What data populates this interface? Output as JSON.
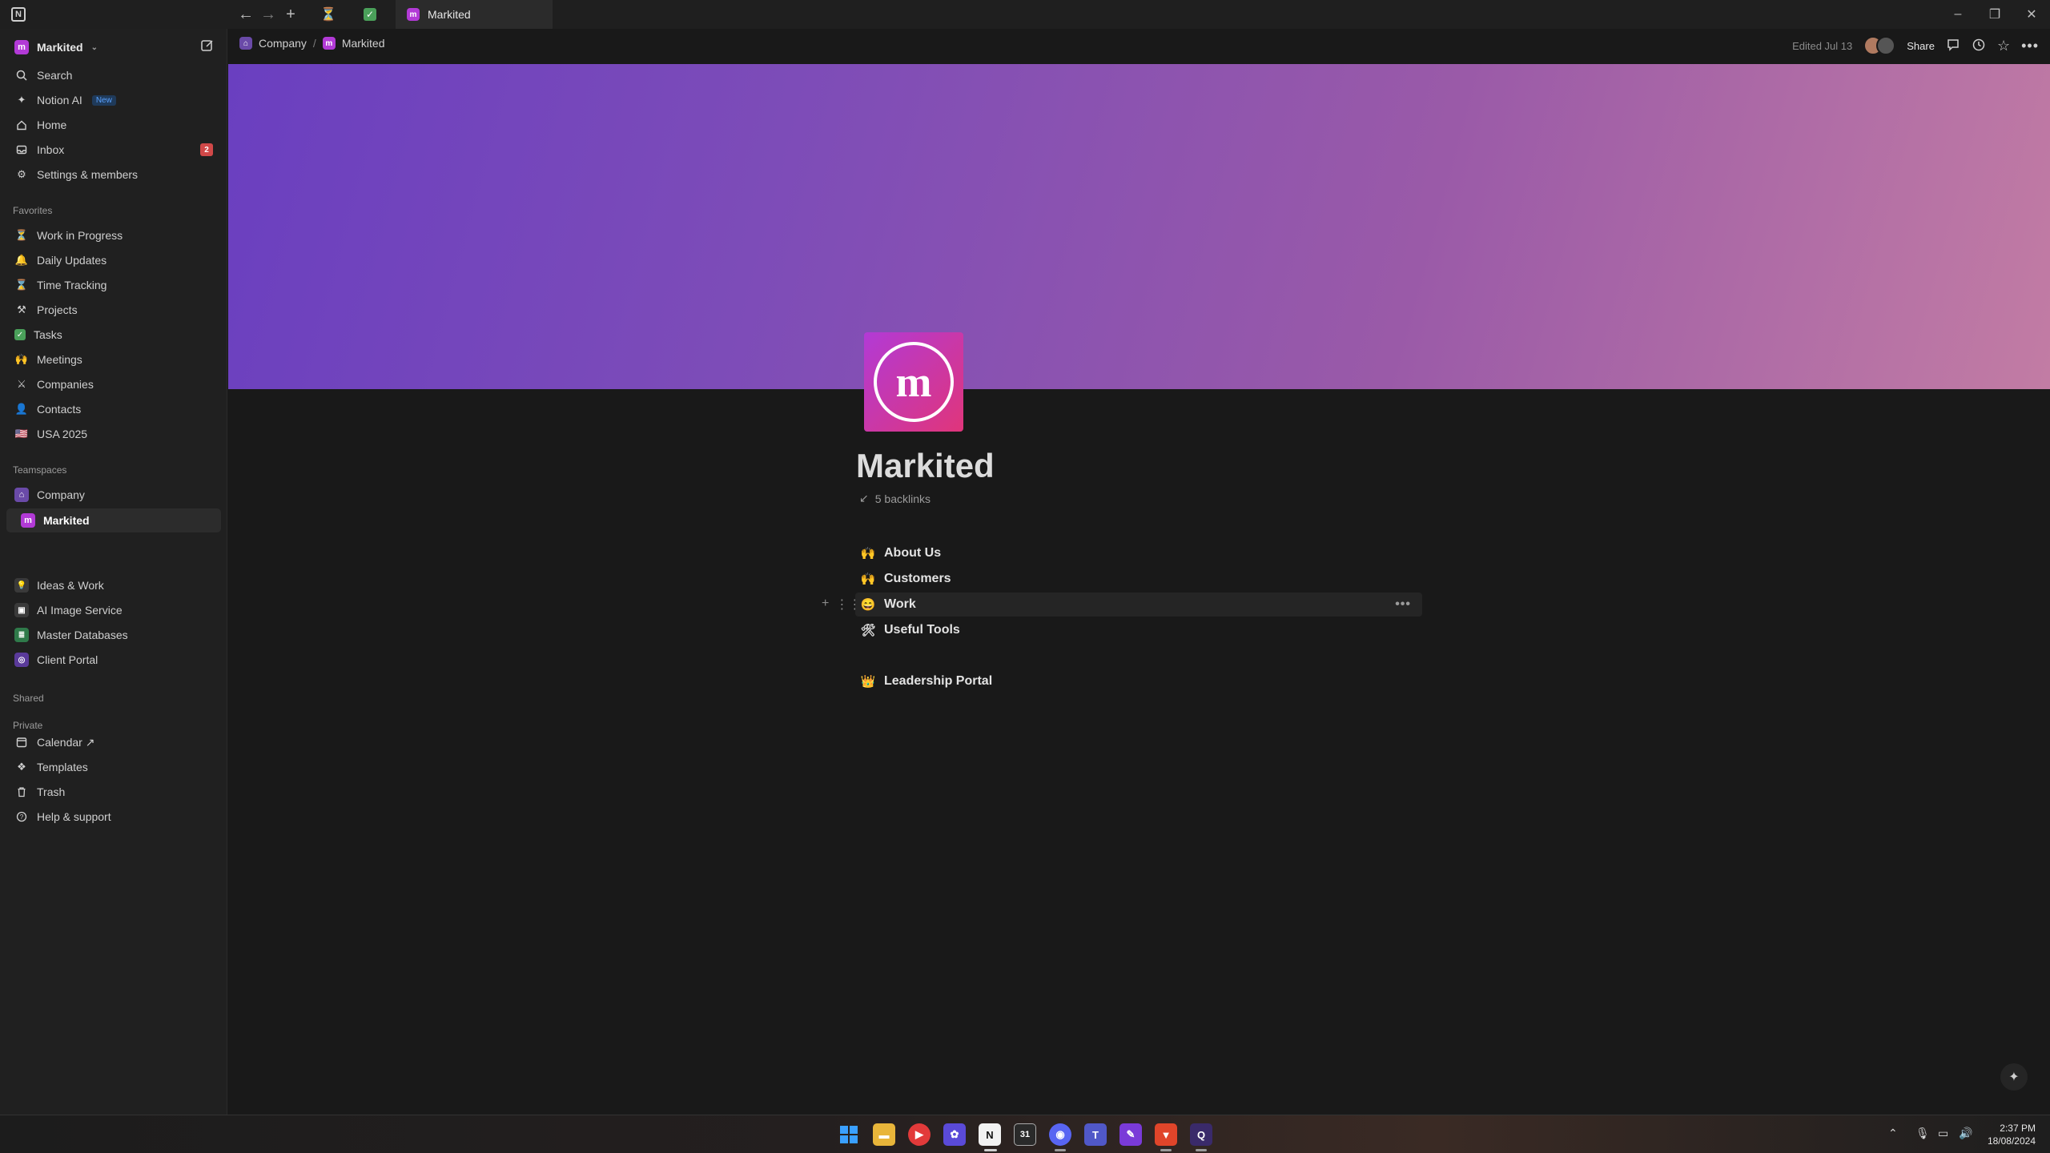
{
  "titlebar": {
    "active_tab": "Markited"
  },
  "workspace": {
    "name": "Markited"
  },
  "sidebar": {
    "top_items": [
      {
        "label": "Search",
        "icon": "search-icon"
      },
      {
        "label": "Notion AI",
        "badge": "New",
        "icon": "sparkle-icon"
      },
      {
        "label": "Home",
        "icon": "home-icon"
      },
      {
        "label": "Inbox",
        "count": "2",
        "icon": "inbox-icon"
      },
      {
        "label": "Settings & members",
        "icon": "gear-icon"
      }
    ],
    "favorites_label": "Favorites",
    "favorites": [
      {
        "label": "Work in Progress",
        "emoji": "⏳"
      },
      {
        "label": "Daily Updates",
        "emoji": "🔔"
      },
      {
        "label": "Time Tracking",
        "emoji": "⌛"
      },
      {
        "label": "Projects",
        "emoji": "⚒"
      },
      {
        "label": "Tasks",
        "emoji": "✅"
      },
      {
        "label": "Meetings",
        "emoji": "🙌"
      },
      {
        "label": "Companies",
        "emoji": "⚔"
      },
      {
        "label": "Contacts",
        "emoji": "👤"
      },
      {
        "label": "USA 2025",
        "emoji": "🇺🇸"
      }
    ],
    "teamspaces_label": "Teamspaces",
    "teamspaces": [
      {
        "label": "Company"
      },
      {
        "label": "Markited"
      }
    ],
    "other_spaces": [
      {
        "label": "Ideas & Work"
      },
      {
        "label": "AI Image Service"
      },
      {
        "label": "Master Databases"
      },
      {
        "label": "Client Portal"
      }
    ],
    "shared_label": "Shared",
    "private_label": "Private",
    "bottom_items": [
      {
        "label": "Calendar ↗",
        "icon": "calendar-icon"
      },
      {
        "label": "Templates",
        "icon": "templates-icon"
      },
      {
        "label": "Trash",
        "icon": "trash-icon"
      },
      {
        "label": "Help & support",
        "icon": "help-icon"
      }
    ]
  },
  "topbar": {
    "breadcrumb": [
      "Company",
      "Markited"
    ],
    "edited": "Edited Jul 13",
    "share": "Share"
  },
  "page": {
    "title": "Markited",
    "backlinks": "5 backlinks",
    "links": [
      {
        "emoji": "🙌",
        "label": "About Us"
      },
      {
        "emoji": "🙌",
        "label": "Customers"
      },
      {
        "emoji": "😄",
        "label": "Work"
      },
      {
        "emoji": "🛠",
        "label": "Useful Tools"
      },
      {
        "emoji": "👑",
        "label": "Leadership Portal"
      }
    ]
  },
  "taskbar": {
    "time": "2:37 PM",
    "date": "18/08/2024"
  },
  "colors": {
    "cover_start": "#6a3fc0",
    "cover_end": "#c27ca4",
    "inbox_badge": "#d04848",
    "new_badge": "#5aa2ff"
  }
}
